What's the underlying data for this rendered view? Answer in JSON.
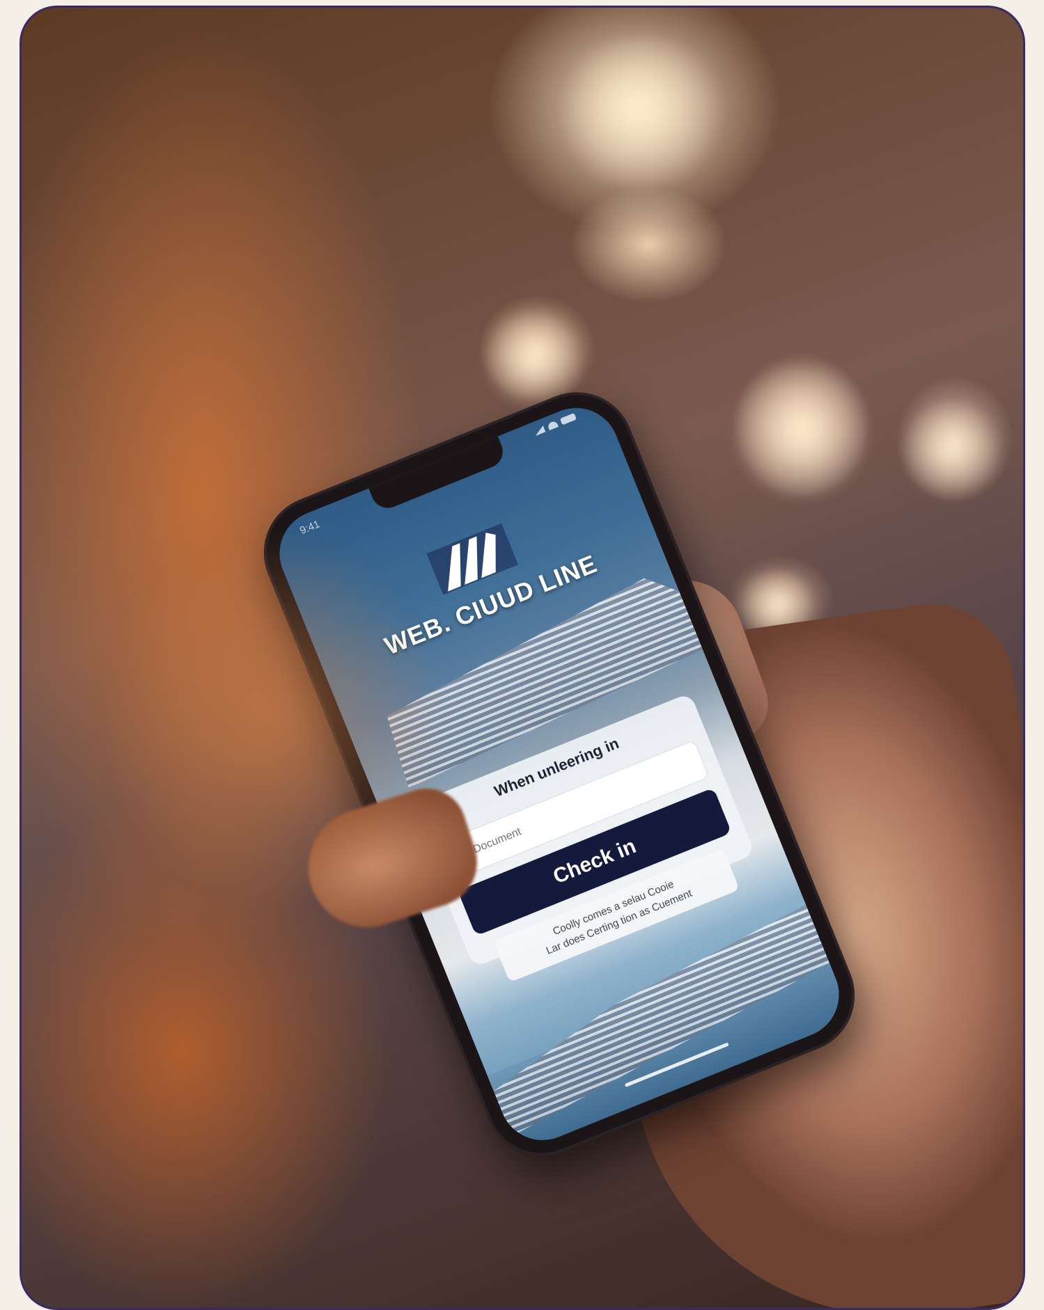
{
  "phone_screen": {
    "status_time": "9:41",
    "brand_name": "WEB. CIUUD LINE",
    "card_title": "When unleering in",
    "search": {
      "placeholder": "Document"
    },
    "checkin_button_label": "Check in",
    "note_lines": [
      "Coolly comes a selau Cooie",
      "Lar does Certing tion as Cuement"
    ]
  },
  "colors": {
    "checkin_button": "#141a3c",
    "screen_top": "#2f5b86",
    "frame_border": "#3b2a63"
  },
  "icons": [
    "ship-logo-icon",
    "search-icon",
    "signal-icon",
    "wifi-icon",
    "battery-icon"
  ]
}
